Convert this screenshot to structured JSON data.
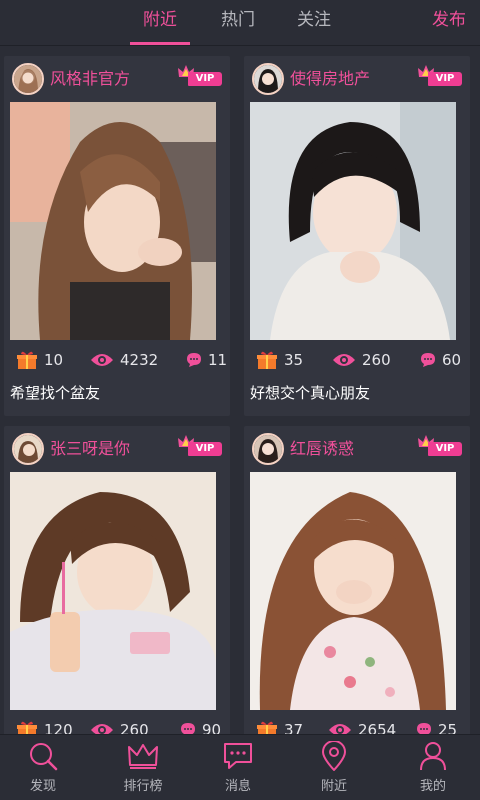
{
  "header": {
    "tabs": [
      {
        "label": "附近",
        "active": true
      },
      {
        "label": "热门",
        "active": false
      },
      {
        "label": "关注",
        "active": false
      }
    ],
    "publish_label": "发布"
  },
  "cards": [
    {
      "username": "风格非官方",
      "vip_label": "VIP",
      "gifts": "10",
      "views": "4232",
      "comments": "11",
      "caption": "希望找个盆友"
    },
    {
      "username": "使得房地产",
      "vip_label": "VIP",
      "gifts": "35",
      "views": "260",
      "comments": "60",
      "caption": "好想交个真心朋友"
    },
    {
      "username": "张三呀是你",
      "vip_label": "VIP",
      "gifts": "120",
      "views": "260",
      "comments": "90",
      "caption": ""
    },
    {
      "username": "红唇诱惑",
      "vip_label": "VIP",
      "gifts": "37",
      "views": "2654",
      "comments": "25",
      "caption": ""
    }
  ],
  "nav": [
    {
      "label": "发现",
      "icon": "search-icon"
    },
    {
      "label": "排行榜",
      "icon": "crown-icon"
    },
    {
      "label": "消息",
      "icon": "message-icon"
    },
    {
      "label": "附近",
      "icon": "location-icon"
    },
    {
      "label": "我的",
      "icon": "user-icon"
    }
  ],
  "colors": {
    "accent": "#f0509a",
    "background": "#2b2d36",
    "card": "#33353f",
    "text_muted": "#b6b7bd"
  }
}
